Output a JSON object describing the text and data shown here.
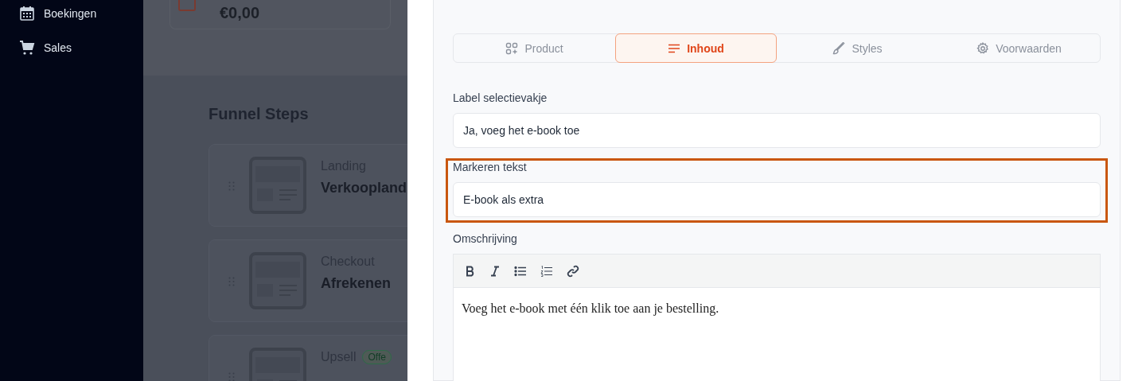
{
  "sidebar": {
    "items": [
      {
        "label": "Boekingen"
      },
      {
        "label": "Sales"
      }
    ]
  },
  "background": {
    "amount": "€0,00",
    "section_title": "Funnel Steps",
    "steps": [
      {
        "type": "Landing",
        "name": "Verkoopland"
      },
      {
        "type": "Checkout",
        "name": "Afrekenen"
      },
      {
        "type": "Upsell",
        "badge": "Offe"
      }
    ]
  },
  "drawer": {
    "tabs": [
      {
        "label": "Product",
        "selected": false
      },
      {
        "label": "Inhoud",
        "selected": true
      },
      {
        "label": "Styles",
        "selected": false
      },
      {
        "label": "Voorwaarden",
        "selected": false
      }
    ],
    "fields": [
      {
        "label": "Label selectievakje",
        "value": "Ja, voeg het e-book toe",
        "highlighted": false
      },
      {
        "label": "Markeren tekst",
        "value": "E-book als extra",
        "highlighted": true
      }
    ],
    "editor": {
      "label": "Omschrijving",
      "content": "Voeg het e-book met één klik toe aan je bestelling."
    }
  }
}
